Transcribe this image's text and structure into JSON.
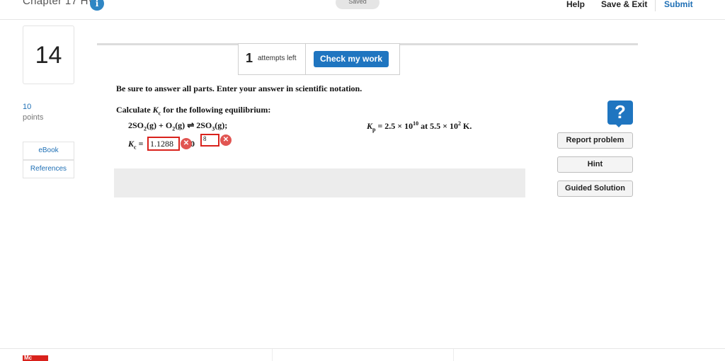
{
  "header": {
    "title": "Chapter 17 HW",
    "info_icon": "i",
    "status": "Saved",
    "help": "Help",
    "save_exit": "Save & Exit",
    "submit": "Submit"
  },
  "sidebar": {
    "question_number": "14",
    "points_value": "10",
    "points_label": "points",
    "links": [
      "eBook",
      "References"
    ]
  },
  "attempts": {
    "count": "1",
    "label": "attempts left",
    "check_button": "Check my work"
  },
  "question": {
    "instructions": "Be sure to answer all parts. Enter your answer in scientific notation.",
    "calc_prefix": "Calculate ",
    "calc_symbol": "K",
    "calc_sub": "c",
    "calc_suffix": " for the following equilibrium:",
    "equation": {
      "t1": "2SO",
      "s1": "2",
      "t2": "(g) + O",
      "s2": "2",
      "t3": "(g) ",
      "arrow": "⇌",
      "t4": " 2SO",
      "s3": "3",
      "t5": "(g);"
    },
    "kp": {
      "symbol": "K",
      "sub": "p",
      "t1": " = 2.5 × 10",
      "exp1": "10",
      "t2": " at 5.5 × 10",
      "exp2": "2",
      "t3": " K."
    },
    "answer": {
      "symbol": "K",
      "sub": "c",
      "equals": " =",
      "mantissa_value": "1.1288",
      "times_ten": "0",
      "exponent_value": "8",
      "status": "incorrect"
    }
  },
  "right_panel": {
    "help_icon": "?",
    "buttons": [
      "Report problem",
      "Hint",
      "Guided Solution"
    ]
  },
  "footer": {
    "logo_text": "Mc"
  },
  "colors": {
    "accent": "#1f75c0",
    "error": "#d9221c"
  }
}
